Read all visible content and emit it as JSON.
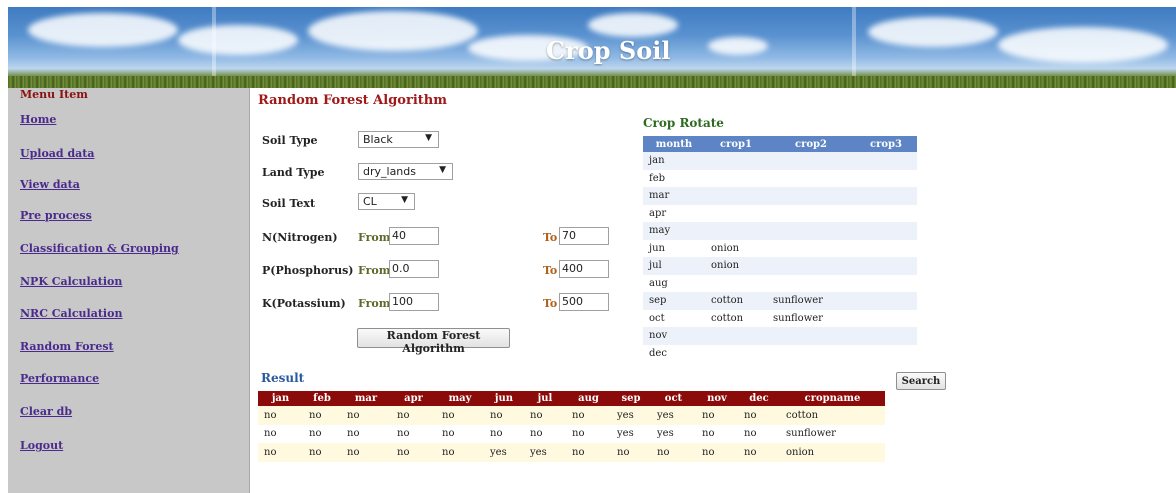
{
  "banner": {
    "title": "Crop Soil"
  },
  "sidebar": {
    "heading": "Menu Item",
    "items": [
      {
        "label": "Home"
      },
      {
        "label": "Upload data"
      },
      {
        "label": "View data"
      },
      {
        "label": "Pre process"
      },
      {
        "label": "Classification & Grouping"
      },
      {
        "label": "NPK Calculation"
      },
      {
        "label": "NRC Calculation"
      },
      {
        "label": "Random Forest"
      },
      {
        "label": "Performance"
      },
      {
        "label": "Clear db"
      },
      {
        "label": "Logout"
      }
    ]
  },
  "form": {
    "title": "Random Forest Algorithm",
    "soil_type": {
      "label": "Soil Type",
      "value": "Black"
    },
    "land_type": {
      "label": "Land Type",
      "value": "dry_lands"
    },
    "soil_text": {
      "label": "Soil Text",
      "value": "CL"
    },
    "nitrogen": {
      "label": "N(Nitrogen)",
      "from_label": "From",
      "from": "40",
      "to_label": "To",
      "to": "70"
    },
    "phosphorus": {
      "label": "P(Phosphorus)",
      "from_label": "From",
      "from": "0.0",
      "to_label": "To",
      "to": "400"
    },
    "potassium": {
      "label": "K(Potassium)",
      "from_label": "From",
      "from": "100",
      "to_label": "To",
      "to": "500"
    },
    "submit_label": "Random Forest Algorithm"
  },
  "crop_rotate": {
    "title": "Crop Rotate",
    "headers": [
      "month",
      "crop1",
      "crop2",
      "crop3"
    ],
    "rows": [
      [
        "jan",
        "",
        "",
        ""
      ],
      [
        "feb",
        "",
        "",
        ""
      ],
      [
        "mar",
        "",
        "",
        ""
      ],
      [
        "apr",
        "",
        "",
        ""
      ],
      [
        "may",
        "",
        "",
        ""
      ],
      [
        "jun",
        "onion",
        "",
        ""
      ],
      [
        "jul",
        "onion",
        "",
        ""
      ],
      [
        "aug",
        "",
        "",
        ""
      ],
      [
        "sep",
        "cotton",
        "sunflower",
        ""
      ],
      [
        "oct",
        "cotton",
        "sunflower",
        ""
      ],
      [
        "nov",
        "",
        "",
        ""
      ],
      [
        "dec",
        "",
        "",
        ""
      ]
    ]
  },
  "result": {
    "title": "Result",
    "search_label": "Search",
    "headers": [
      "jan",
      "feb",
      "mar",
      "apr",
      "may",
      "jun",
      "jul",
      "aug",
      "sep",
      "oct",
      "nov",
      "dec",
      "cropname"
    ],
    "rows": [
      [
        "no",
        "no",
        "no",
        "no",
        "no",
        "no",
        "no",
        "no",
        "yes",
        "yes",
        "no",
        "no",
        "cotton"
      ],
      [
        "no",
        "no",
        "no",
        "no",
        "no",
        "no",
        "no",
        "no",
        "yes",
        "yes",
        "no",
        "no",
        "sunflower"
      ],
      [
        "no",
        "no",
        "no",
        "no",
        "no",
        "yes",
        "yes",
        "no",
        "no",
        "no",
        "no",
        "no",
        "onion"
      ]
    ]
  }
}
